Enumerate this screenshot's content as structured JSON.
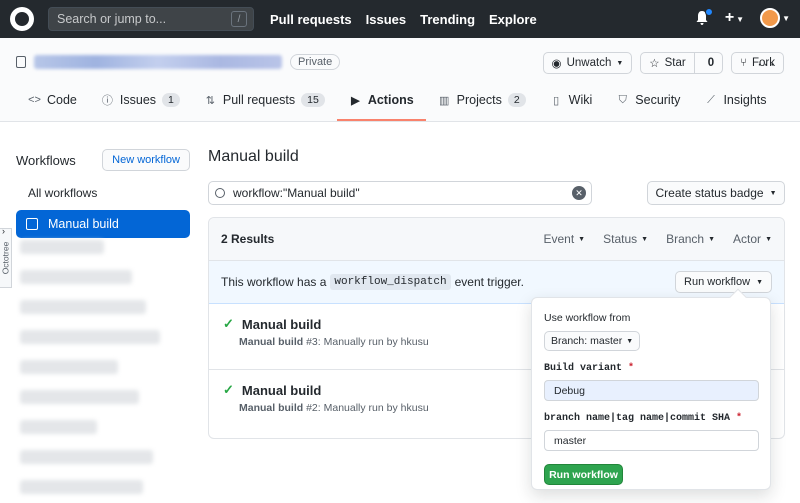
{
  "topbar": {
    "search_placeholder": "Search or jump to...",
    "search_shortcut": "/",
    "nav": [
      "Pull requests",
      "Issues",
      "Trending",
      "Explore"
    ]
  },
  "repo": {
    "visibility": "Private",
    "unwatch": "Unwatch",
    "star": "Star",
    "star_count": "0",
    "fork": "Fork"
  },
  "tabs": [
    {
      "label": "Code",
      "icon": "code-icon"
    },
    {
      "label": "Issues",
      "count": "1",
      "icon": "issue-icon"
    },
    {
      "label": "Pull requests",
      "count": "15",
      "icon": "pull-request-icon"
    },
    {
      "label": "Actions",
      "icon": "play-icon"
    },
    {
      "label": "Projects",
      "count": "2",
      "icon": "project-icon"
    },
    {
      "label": "Wiki",
      "icon": "book-icon"
    },
    {
      "label": "Security",
      "icon": "shield-icon"
    },
    {
      "label": "Insights",
      "icon": "graph-icon"
    }
  ],
  "sidebar": {
    "title": "Workflows",
    "new_workflow": "New workflow",
    "all_workflows": "All workflows",
    "active_workflow": "Manual build",
    "octotree": "Octotree"
  },
  "main": {
    "title": "Manual build",
    "filter_value": "workflow:\"Manual build\"",
    "create_status_badge": "Create status badge",
    "results": "2 Results",
    "filters": [
      "Event",
      "Status",
      "Branch",
      "Actor"
    ],
    "dispatch_text_before": "This workflow has a",
    "dispatch_code": "workflow_dispatch",
    "dispatch_text_after": "event trigger.",
    "run_workflow": "Run workflow",
    "runs": [
      {
        "name": "Manual build",
        "meta_bold": "Manual build",
        "meta": "#3: Manually run by hkusu"
      },
      {
        "name": "Manual build",
        "meta_bold": "Manual build",
        "meta": "#2: Manually run by hkusu"
      }
    ]
  },
  "popup": {
    "use_from": "Use workflow from",
    "branch": "Branch: master",
    "field1_label": "Build variant",
    "field1_value": "Debug",
    "field2_label": "branch name|tag name|commit SHA",
    "field2_value": "master",
    "submit": "Run workflow",
    "required_mark": "*"
  }
}
